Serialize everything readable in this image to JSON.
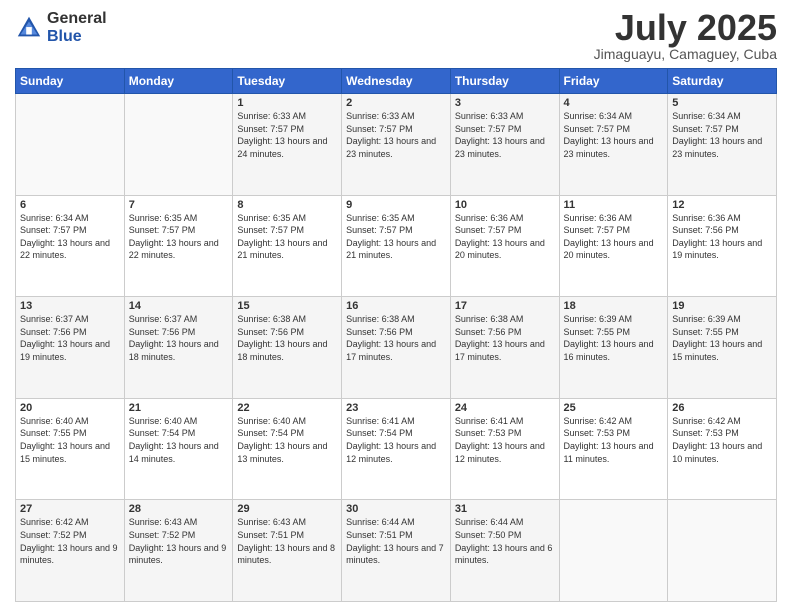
{
  "logo": {
    "general": "General",
    "blue": "Blue"
  },
  "title": "July 2025",
  "subtitle": "Jimaguayu, Camaguey, Cuba",
  "days_of_week": [
    "Sunday",
    "Monday",
    "Tuesday",
    "Wednesday",
    "Thursday",
    "Friday",
    "Saturday"
  ],
  "weeks": [
    [
      {
        "day": "",
        "info": ""
      },
      {
        "day": "",
        "info": ""
      },
      {
        "day": "1",
        "info": "Sunrise: 6:33 AM\nSunset: 7:57 PM\nDaylight: 13 hours and 24 minutes."
      },
      {
        "day": "2",
        "info": "Sunrise: 6:33 AM\nSunset: 7:57 PM\nDaylight: 13 hours and 23 minutes."
      },
      {
        "day": "3",
        "info": "Sunrise: 6:33 AM\nSunset: 7:57 PM\nDaylight: 13 hours and 23 minutes."
      },
      {
        "day": "4",
        "info": "Sunrise: 6:34 AM\nSunset: 7:57 PM\nDaylight: 13 hours and 23 minutes."
      },
      {
        "day": "5",
        "info": "Sunrise: 6:34 AM\nSunset: 7:57 PM\nDaylight: 13 hours and 23 minutes."
      }
    ],
    [
      {
        "day": "6",
        "info": "Sunrise: 6:34 AM\nSunset: 7:57 PM\nDaylight: 13 hours and 22 minutes."
      },
      {
        "day": "7",
        "info": "Sunrise: 6:35 AM\nSunset: 7:57 PM\nDaylight: 13 hours and 22 minutes."
      },
      {
        "day": "8",
        "info": "Sunrise: 6:35 AM\nSunset: 7:57 PM\nDaylight: 13 hours and 21 minutes."
      },
      {
        "day": "9",
        "info": "Sunrise: 6:35 AM\nSunset: 7:57 PM\nDaylight: 13 hours and 21 minutes."
      },
      {
        "day": "10",
        "info": "Sunrise: 6:36 AM\nSunset: 7:57 PM\nDaylight: 13 hours and 20 minutes."
      },
      {
        "day": "11",
        "info": "Sunrise: 6:36 AM\nSunset: 7:57 PM\nDaylight: 13 hours and 20 minutes."
      },
      {
        "day": "12",
        "info": "Sunrise: 6:36 AM\nSunset: 7:56 PM\nDaylight: 13 hours and 19 minutes."
      }
    ],
    [
      {
        "day": "13",
        "info": "Sunrise: 6:37 AM\nSunset: 7:56 PM\nDaylight: 13 hours and 19 minutes."
      },
      {
        "day": "14",
        "info": "Sunrise: 6:37 AM\nSunset: 7:56 PM\nDaylight: 13 hours and 18 minutes."
      },
      {
        "day": "15",
        "info": "Sunrise: 6:38 AM\nSunset: 7:56 PM\nDaylight: 13 hours and 18 minutes."
      },
      {
        "day": "16",
        "info": "Sunrise: 6:38 AM\nSunset: 7:56 PM\nDaylight: 13 hours and 17 minutes."
      },
      {
        "day": "17",
        "info": "Sunrise: 6:38 AM\nSunset: 7:56 PM\nDaylight: 13 hours and 17 minutes."
      },
      {
        "day": "18",
        "info": "Sunrise: 6:39 AM\nSunset: 7:55 PM\nDaylight: 13 hours and 16 minutes."
      },
      {
        "day": "19",
        "info": "Sunrise: 6:39 AM\nSunset: 7:55 PM\nDaylight: 13 hours and 15 minutes."
      }
    ],
    [
      {
        "day": "20",
        "info": "Sunrise: 6:40 AM\nSunset: 7:55 PM\nDaylight: 13 hours and 15 minutes."
      },
      {
        "day": "21",
        "info": "Sunrise: 6:40 AM\nSunset: 7:54 PM\nDaylight: 13 hours and 14 minutes."
      },
      {
        "day": "22",
        "info": "Sunrise: 6:40 AM\nSunset: 7:54 PM\nDaylight: 13 hours and 13 minutes."
      },
      {
        "day": "23",
        "info": "Sunrise: 6:41 AM\nSunset: 7:54 PM\nDaylight: 13 hours and 12 minutes."
      },
      {
        "day": "24",
        "info": "Sunrise: 6:41 AM\nSunset: 7:53 PM\nDaylight: 13 hours and 12 minutes."
      },
      {
        "day": "25",
        "info": "Sunrise: 6:42 AM\nSunset: 7:53 PM\nDaylight: 13 hours and 11 minutes."
      },
      {
        "day": "26",
        "info": "Sunrise: 6:42 AM\nSunset: 7:53 PM\nDaylight: 13 hours and 10 minutes."
      }
    ],
    [
      {
        "day": "27",
        "info": "Sunrise: 6:42 AM\nSunset: 7:52 PM\nDaylight: 13 hours and 9 minutes."
      },
      {
        "day": "28",
        "info": "Sunrise: 6:43 AM\nSunset: 7:52 PM\nDaylight: 13 hours and 9 minutes."
      },
      {
        "day": "29",
        "info": "Sunrise: 6:43 AM\nSunset: 7:51 PM\nDaylight: 13 hours and 8 minutes."
      },
      {
        "day": "30",
        "info": "Sunrise: 6:44 AM\nSunset: 7:51 PM\nDaylight: 13 hours and 7 minutes."
      },
      {
        "day": "31",
        "info": "Sunrise: 6:44 AM\nSunset: 7:50 PM\nDaylight: 13 hours and 6 minutes."
      },
      {
        "day": "",
        "info": ""
      },
      {
        "day": "",
        "info": ""
      }
    ]
  ]
}
